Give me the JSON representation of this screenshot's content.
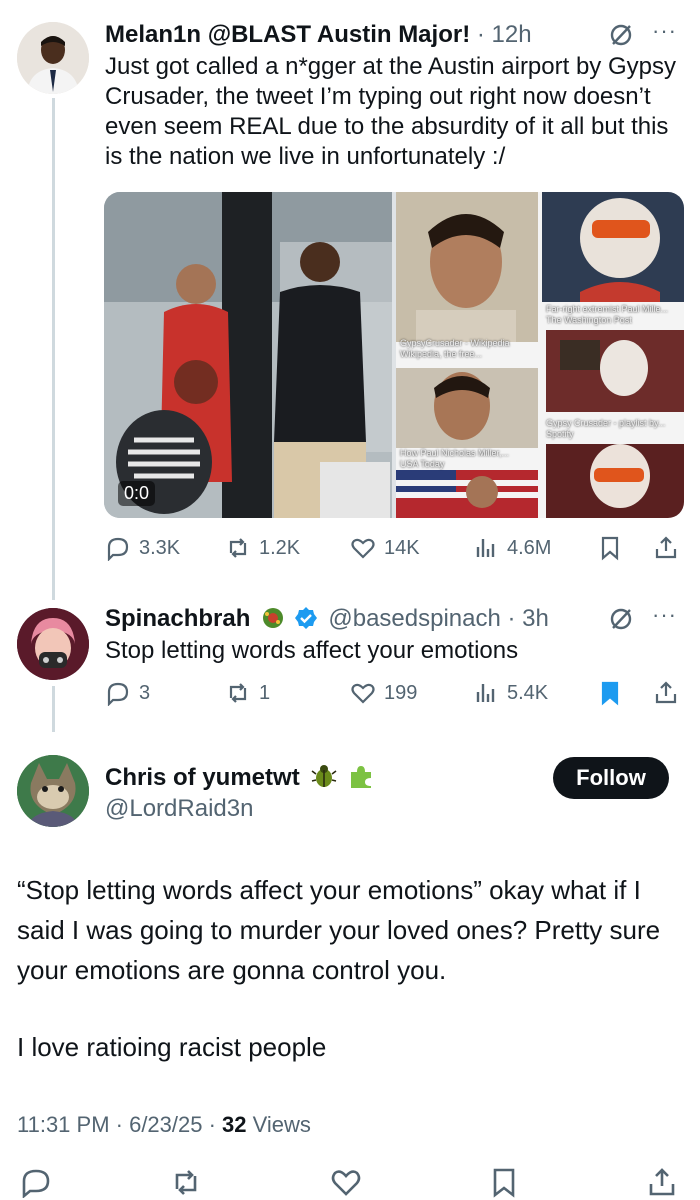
{
  "colors": {
    "text": "#0f1419",
    "secondary": "#536471",
    "blue": "#1d9bf0",
    "thread_line": "#cfd9de"
  },
  "tweet1": {
    "name": "Melan1n @BLAST Austin Major!",
    "meta": "· 12h",
    "text": "Just got called a n*gger at the Austin airport by Gypsy Crusader, the tweet I’m typing out right now doesn’t even seem REAL due to the absurdity of it all but this is the nation we live in unfortunately :/",
    "media": {
      "video_time": "0:0",
      "captions": [
        "Far-right extremist Paul Mille...",
        "The Washington Post",
        "GypsyCrusader - Wikipedia",
        "Wikipedia, the free...",
        "Gypsy Crusader - playlist by...",
        "Spotify",
        "How Paul Nicholas Miller,...",
        "USA Today"
      ]
    },
    "stats": {
      "replies": "3.3K",
      "reposts": "1.2K",
      "likes": "14K",
      "views": "4.6M"
    }
  },
  "tweet2": {
    "name": "Spinachbrah",
    "meta": "@basedspinach · 3h",
    "text": "Stop letting words affect your emotions",
    "stats": {
      "replies": "3",
      "reposts": "1",
      "likes": "199",
      "views": "5.4K"
    }
  },
  "main": {
    "name": "Chris of yumetwt",
    "handle": "@LordRaid3n",
    "follow_label": "Follow",
    "paragraph1": "“Stop letting words affect your emotions” okay what if I said I was going to murder your loved ones? Pretty sure your emotions are gonna control you.",
    "paragraph2": "I love ratioing racist people",
    "time": "11:31 PM · 6/23/25 · ",
    "views_count": "32",
    "views_label": " Views"
  },
  "icons": [
    "reply-icon",
    "repost-icon",
    "like-icon",
    "views-icon",
    "bookmark-icon",
    "share-icon",
    "grok-icon",
    "more-icon",
    "verified-icon"
  ]
}
